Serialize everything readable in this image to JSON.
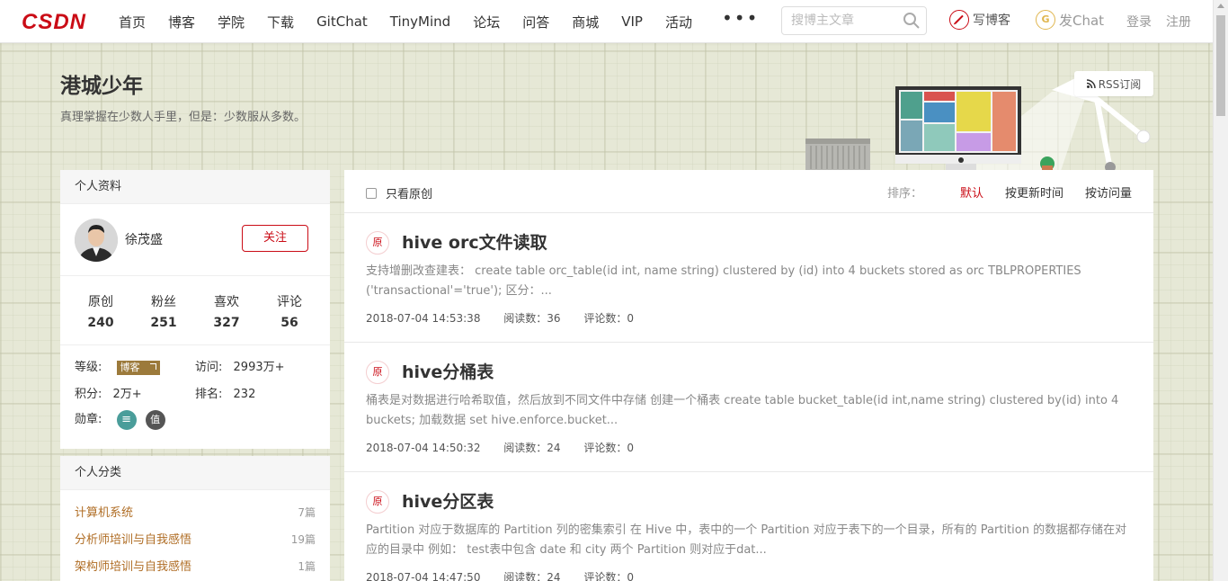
{
  "topnav": {
    "logo_text": "CSDN",
    "items": [
      "首页",
      "博客",
      "学院",
      "下载",
      "GitChat",
      "TinyMind",
      "论坛",
      "问答",
      "商城",
      "VIP",
      "活动"
    ],
    "more": "•••",
    "search_placeholder": "搜博主文章",
    "write_label": "写博客",
    "write_icon": "pen-icon",
    "gitchat_label": "发Chat",
    "gitchat_icon": "gitchat-icon",
    "login": "登录",
    "register": "注册"
  },
  "blog": {
    "title": "港城少年",
    "description": "真理掌握在少数人手里，但是：少数服从多数。",
    "rss_label": "RSS订阅"
  },
  "profile_card": {
    "heading": "个人资料",
    "username": "徐茂盛",
    "follow_label": "关注",
    "stats": [
      {
        "label": "原创",
        "value": "240"
      },
      {
        "label": "粉丝",
        "value": "251"
      },
      {
        "label": "喜欢",
        "value": "327"
      },
      {
        "label": "评论",
        "value": "56"
      }
    ],
    "level_label": "等级:",
    "level_badge": "博客",
    "visits_label": "访问:",
    "visits_value": "2993万+",
    "points_label": "积分:",
    "points_value": "2万+",
    "rank_label": "排名:",
    "rank_value": "232",
    "medals_label": "勋章:",
    "medals": [
      "list-medal-icon",
      "value-medal-icon"
    ],
    "medal_glyphs": [
      "≡",
      "值"
    ]
  },
  "category_card": {
    "heading": "个人分类",
    "items": [
      {
        "name": "计算机系统",
        "count": "7篇"
      },
      {
        "name": "分析师培训与自我感悟",
        "count": "19篇"
      },
      {
        "name": "架构师培训与自我感悟",
        "count": "1篇"
      }
    ]
  },
  "filter": {
    "only_original": "只看原创",
    "sort_label": "排序：",
    "sort_default": "默认",
    "sort_update": "按更新时间",
    "sort_visits": "按访问量"
  },
  "articles": [
    {
      "tag": "原",
      "title": "hive orc文件读取",
      "abstract": "支持增删改查建表：  create table orc_table(id int, name string) clustered by (id) into 4 buckets stored as orc TBLPROPERTIES ('transactional'='true'); 区分：...",
      "date": "2018-07-04 14:53:38",
      "reads": "阅读数：36",
      "comments": "评论数：0"
    },
    {
      "tag": "原",
      "title": "hive分桶表",
      "abstract": "桶表是对数据进行哈希取值，然后放到不同文件中存储 创建一个桶表 create table bucket_table(id int,name string) clustered by(id) into 4 buckets; 加载数据 set hive.enforce.bucket...",
      "date": "2018-07-04 14:50:32",
      "reads": "阅读数：24",
      "comments": "评论数：0"
    },
    {
      "tag": "原",
      "title": "hive分区表",
      "abstract": "Partition 对应于数据库的 Partition 列的密集索引 在 Hive 中，表中的一个 Partition 对应于表下的一个目录，所有的 Partition 的数据都存储在对应的目录中 例如：  test表中包含 date 和 city 两个 Partition 则对应于dat...",
      "date": "2018-07-04 14:47:50",
      "reads": "阅读数：24",
      "comments": "评论数：0"
    }
  ],
  "colors": {
    "brand_red": "#ca0c16",
    "category_link": "#b06e26",
    "level_badge": "#9c7a3b"
  }
}
